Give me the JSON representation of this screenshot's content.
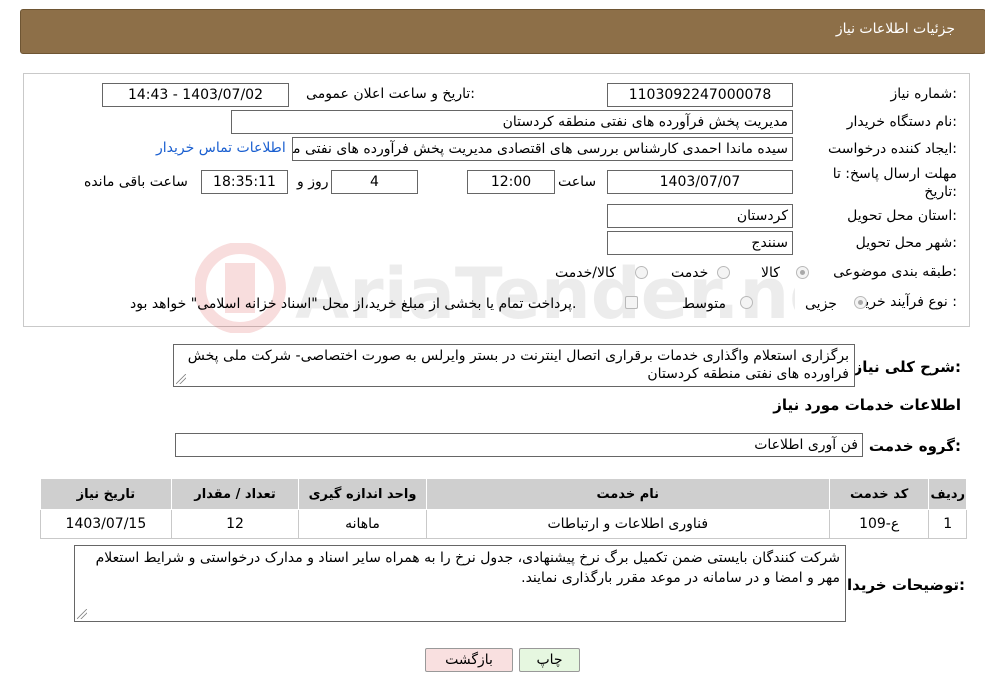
{
  "header": {
    "title": "جزئیات اطلاعات نیاز"
  },
  "form": {
    "need_number": {
      "label": "شماره نیاز:",
      "value": "1103092247000078"
    },
    "announce_datetime": {
      "label": "تاریخ و ساعت اعلان عمومی:",
      "value": "1403/07/02 - 14:43"
    },
    "buyer_org": {
      "label": "نام دستگاه خریدار:",
      "value": "مدیریت پخش فرآورده های نفتی منطقه کردستان"
    },
    "requester": {
      "label": "ایجاد کننده درخواست:",
      "value": "سیده ماندا احمدی کارشناس بررسی های اقتصادی مدیریت پخش فرآورده های نفتی منطقه کردستان"
    },
    "contact_link": "اطلاعات تماس خریدار",
    "deadline": {
      "label": "مهلت ارسال پاسخ: تا تاریخ:",
      "date": "1403/07/07",
      "time_label": "ساعت",
      "time": "12:00",
      "days": "4",
      "days_label": "روز و",
      "remaining": "18:35:11",
      "remaining_label": "ساعت باقی مانده"
    },
    "province": {
      "label": "استان محل تحویل:",
      "value": "کردستان"
    },
    "city": {
      "label": "شهر محل تحویل:",
      "value": "سنندج"
    },
    "category": {
      "label": "طبقه بندی موضوعی:",
      "options": [
        "کالا",
        "خدمت",
        "کالا/خدمت"
      ],
      "selected": "کالا"
    },
    "purchase_type": {
      "label": "نوع فرآیند خرید :",
      "options": [
        "جزیی",
        "متوسط"
      ],
      "selected": "جزیی",
      "note": "پرداخت تمام یا بخشی از مبلغ خرید،از محل \"اسناد خزانه اسلامی\" خواهد بود."
    }
  },
  "description": {
    "label": "شرح کلی نیاز:",
    "value": "برگزاری استعلام واگذاری خدمات برقراری اتصال اینترنت در بستر وایرلس به صورت اختصاصی- شرکت ملی پخش فراورده های نفتی منطقه کردستان"
  },
  "services_section": {
    "title": "اطلاعات خدمات مورد نیاز",
    "group_label": "گروه خدمت:",
    "group_value": "فن آوری اطلاعات",
    "columns": [
      "ردیف",
      "کد خدمت",
      "نام خدمت",
      "واحد اندازه گیری",
      "تعداد / مقدار",
      "تاریخ نیاز"
    ],
    "rows": [
      [
        "1",
        "ع-109",
        "فناوری اطلاعات و ارتباطات",
        "ماهانه",
        "12",
        "1403/07/15"
      ]
    ]
  },
  "buyer_notes": {
    "label": "توضیحات خریدار:",
    "value": "شرکت کنندگان بایستی ضمن تکمیل برگ نرخ پیشنهادی، جدول نرخ را به همراه سایر اسناد و مدارک درخواستی و شرایط استعلام  مهر و امضا و در سامانه در موعد مقرر بارگذاری نمایند."
  },
  "buttons": {
    "print": "چاپ",
    "back": "بازگشت"
  },
  "colors": {
    "header_bg": "#8d6f48",
    "table_head": "#cfcfcf",
    "back_btn": "#f9e0e0",
    "print_btn": "#e6f7e0"
  }
}
